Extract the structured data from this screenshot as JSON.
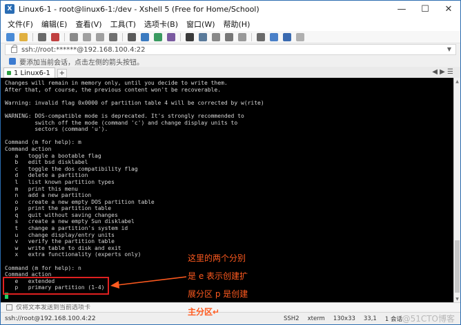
{
  "window": {
    "title": "Linux6-1 - root@linux6-1:/dev - Xshell 5 (Free for Home/School)",
    "controls": [
      "—",
      "☐",
      "✕"
    ]
  },
  "menu": {
    "items": [
      "文件(F)",
      "编辑(E)",
      "查看(V)",
      "工具(T)",
      "选项卡(B)",
      "窗口(W)",
      "帮助(H)"
    ]
  },
  "address": {
    "value": "ssh://root:******@192.168.100.4:22"
  },
  "hint": {
    "text": "要添加当前会话，点击左侧的箭头按钮。"
  },
  "tabs": {
    "active": "1 Linux6-1",
    "add": "+"
  },
  "terminal": {
    "lines": [
      "Changes will remain in memory only, until you decide to write them.",
      "After that, of course, the previous content won't be recoverable.",
      "",
      "Warning: invalid flag 0x0000 of partition table 4 will be corrected by w(rite)",
      "",
      "WARNING: DOS-compatible mode is deprecated. It's strongly recommended to",
      "         switch off the mode (command 'c') and change display units to",
      "         sectors (command 'u').",
      "",
      "Command (m for help): m",
      "Command action",
      "   a   toggle a bootable flag",
      "   b   edit bsd disklabel",
      "   c   toggle the dos compatibility flag",
      "   d   delete a partition",
      "   l   list known partition types",
      "   m   print this menu",
      "   n   add a new partition",
      "   o   create a new empty DOS partition table",
      "   p   print the partition table",
      "   q   quit without saving changes",
      "   s   create a new empty Sun disklabel",
      "   t   change a partition's system id",
      "   u   change display/entry units",
      "   v   verify the partition table",
      "   w   write table to disk and exit",
      "   x   extra functionality (experts only)",
      "",
      "Command (m for help): n",
      "Command action",
      "   e   extended",
      "   p   primary partition (1-4)"
    ]
  },
  "annotation": {
    "lines": [
      "这里的两个分别",
      "是 e 表示创建扩",
      "展分区  p 是创建",
      "主分区↵"
    ],
    "color": "#ff5a1f",
    "box_color": "#e02020"
  },
  "input": {
    "placeholder": "仅将文本发送到当前选项卡"
  },
  "status": {
    "connection": "ssh://root@192.168.100.4:22",
    "protocol": "SSH2",
    "term": "xterm",
    "size": "130x33",
    "cursor": "33,1",
    "sessions": "1 会话",
    "watermark": "@51CTO博客"
  },
  "icons": {
    "terminal_cursor_color": "#20d060",
    "accent": "#2a6db4"
  }
}
